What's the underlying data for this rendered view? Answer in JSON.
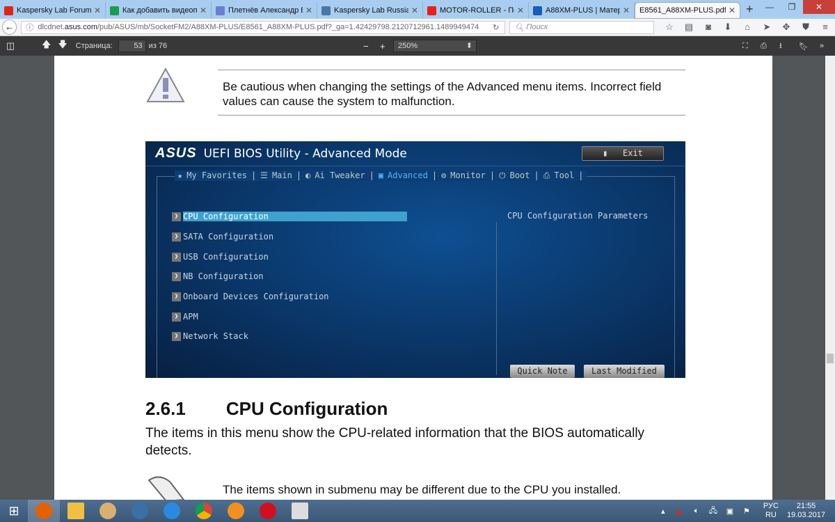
{
  "browser": {
    "tabs": [
      {
        "label": "Kaspersky Lab Forum (...",
        "color": "#e2231a"
      },
      {
        "label": "Как добавить видеоп...",
        "color": "#1b9c52"
      },
      {
        "label": "Плетнёв Александр В...",
        "color": "#6a7fd0"
      },
      {
        "label": "Kaspersky Lab Russia",
        "color": "#4a76a8"
      },
      {
        "label": "MOTOR-ROLLER - Пес...",
        "color": "#e62117"
      },
      {
        "label": "A88XM-PLUS | Матер...",
        "color": "#1a5bb5"
      },
      {
        "label": "E8561_A88XM-PLUS.pdf",
        "color": "#ffffff"
      }
    ],
    "url_prefix": "dlcdnet.",
    "url_domain": "asus.com",
    "url_path": "/pub/ASUS/mb/SocketFM2/A88XM-PLUS/E8561_A88XM-PLUS.pdf?_ga=1.42429798.2120712961.1489949474",
    "search_placeholder": "Поиск"
  },
  "pdf_toolbar": {
    "page_label": "Страница:",
    "page": "53",
    "of": "из 76",
    "zoom": "250%"
  },
  "document": {
    "caution_text": "Be cautious when changing the settings of the Advanced menu items. Incorrect field values can cause the system to malfunction.",
    "bios": {
      "logo": "/ISUS",
      "title": "UEFI BIOS Utility - Advanced Mode",
      "exit": "Exit",
      "menu": [
        "My Favorites",
        "Main",
        "Ai Tweaker",
        "Advanced",
        "Monitor",
        "Boot",
        "Tool"
      ],
      "items": [
        "CPU Configuration",
        "SATA Configuration",
        "USB Configuration",
        "NB Configuration",
        "Onboard Devices Configuration",
        "APM",
        "Network Stack"
      ],
      "description": "CPU Configuration Parameters",
      "quick_note": "Quick Note",
      "last_modified": "Last Modified"
    },
    "section_number": "2.6.1",
    "section_title": "CPU Configuration",
    "body": "The items in this menu show the CPU-related information that the BIOS automatically detects.",
    "note_text": "The items shown in submenu may be different due to the CPU you installed."
  },
  "taskbar": {
    "lang1": "РУС",
    "lang2": "RU",
    "time": "21:55",
    "date": "19.03.2017"
  }
}
